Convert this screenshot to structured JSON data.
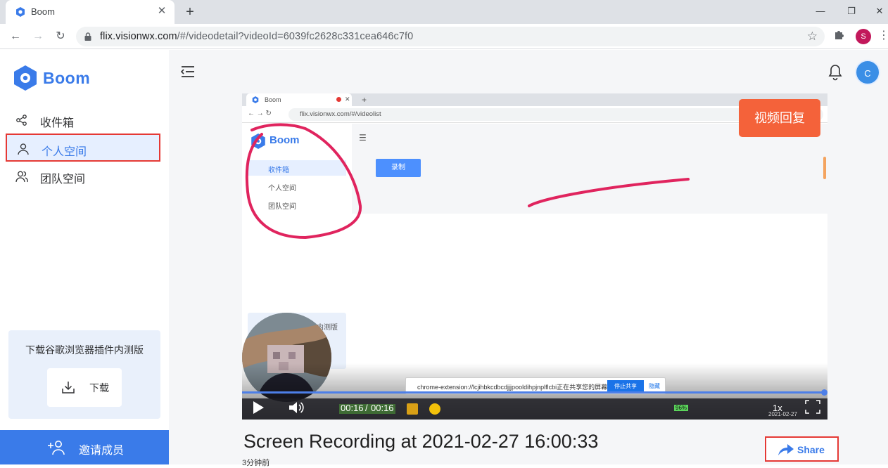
{
  "browser": {
    "tab_title": "Boom",
    "tab_close": "✕",
    "new_tab": "+",
    "url_host": "flix.visionwx.com",
    "url_path": "/#/videodetail?videoId=6039fc2628c331cea646c7f0",
    "profile_initial": "S",
    "window_minimize": "—",
    "window_restore": "❐",
    "window_close": "✕"
  },
  "sidebar": {
    "brand": "Boom",
    "nav": [
      {
        "label": "收件箱",
        "icon": "share-icon"
      },
      {
        "label": "个人空间",
        "icon": "user-icon",
        "active": true
      },
      {
        "label": "团队空间",
        "icon": "team-icon"
      }
    ],
    "download_card": {
      "text": "下载谷歌浏览器插件内测版",
      "button_label": "下载"
    },
    "invite_label": "邀请成员"
  },
  "header": {
    "avatar_initial": "C"
  },
  "player": {
    "inner_tab_title": "Boom",
    "inner_url": "flix.visionwx.com/#/videolist",
    "inner_brand": "Boom",
    "inner_nav": [
      "收件箱",
      "个人空间",
      "团队空间"
    ],
    "inner_record_button": "录制",
    "inner_beta_text": "内测版",
    "recap_tag": "视频回复",
    "share_banner_text": "chrome-extension://lcjihbkcdbcdjjjpooldihpjnplflcbi正在共享您的屏幕。",
    "share_banner_stop": "停止共享",
    "share_banner_hide": "隐藏",
    "taskbar_battery": "96%",
    "taskbar_date": "2021-02-27",
    "current_time": "00:16",
    "time_separator": "/",
    "total_time": "00:16",
    "speed": "1x",
    "progress_fraction": 1.0
  },
  "video": {
    "title": "Screen Recording at 2021-02-27 16:00:33",
    "posted": "3分钟前",
    "share_label": "Share"
  },
  "colors": {
    "brand_blue": "#3a7be9",
    "highlight_red": "#e53935",
    "recap_orange": "#f4623a",
    "annotation_pink": "#e0245e"
  }
}
